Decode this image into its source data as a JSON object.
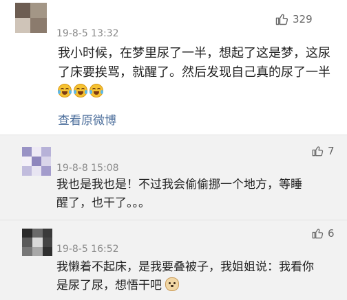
{
  "main_comment": {
    "timestamp": "19-8-5 13:32",
    "like_count": "329",
    "text": "我小时候，在梦里尿了一半，想起了这是梦，这尿了床要挨骂，就醒了。然后发现自己真的尿了一半",
    "emojis": [
      "laughing-crying-emoji",
      "laughing-crying-emoji",
      "laughing-crying-emoji"
    ],
    "view_original_label": "查看原微博"
  },
  "replies": [
    {
      "timestamp": "19-8-8 15:08",
      "like_count": "7",
      "text": "我也是我也是！不过我会偷偷挪一个地方，等睡醒了，也干了。。。"
    },
    {
      "timestamp": "19-8-5 16:52",
      "like_count": "6",
      "text": "我懒着不起床，是我要叠被子，我姐姐说：我看你是尿了尿，想悟干吧",
      "emojis": [
        "doge-emoji"
      ]
    }
  ],
  "icons": {
    "like": "thumbs-up-icon"
  },
  "colors": {
    "link": "#4d6f9c",
    "reply_background": "#f2f2f2",
    "meta_text": "#8a8a8a"
  }
}
